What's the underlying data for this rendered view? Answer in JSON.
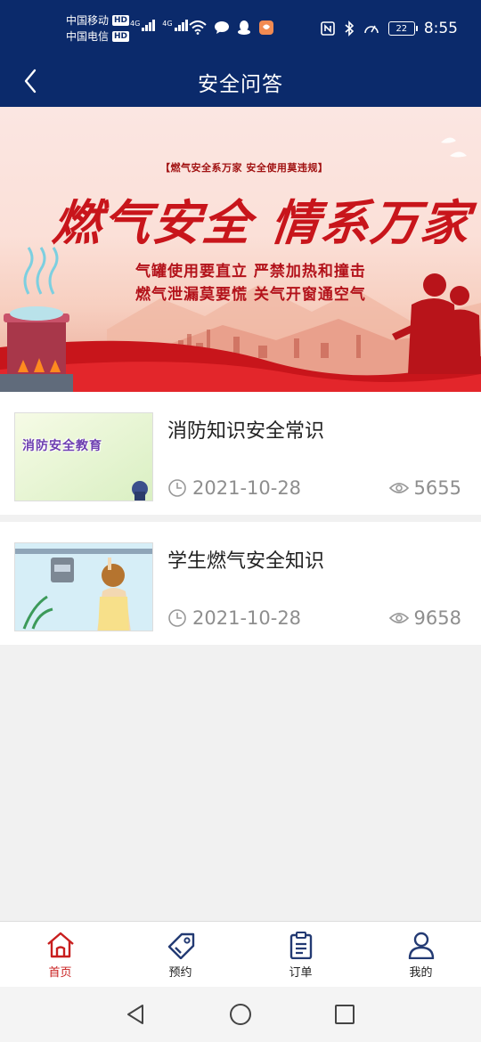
{
  "status_bar": {
    "carrier_1": "中国移动",
    "carrier_2": "中国电信",
    "hd_badge": "HD",
    "net_type": "4G",
    "battery_level": "22",
    "time": "8:55"
  },
  "header": {
    "title": "安全问答",
    "back_icon": "chevron-left-icon"
  },
  "banner": {
    "tag": "【燃气安全系万家 安全使用莫违规】",
    "headline": "燃气安全 情系万家",
    "line_1": "气罐使用要直立 严禁加热和撞击",
    "line_2": "燃气泄漏莫要慌 关气开窗通空气"
  },
  "articles": [
    {
      "title": "消防知识安全常识",
      "date": "2021-10-28",
      "views": "5655",
      "thumb_text": "消防安全教育"
    },
    {
      "title": "学生燃气安全知识",
      "date": "2021-10-28",
      "views": "9658"
    }
  ],
  "bottom_nav": [
    {
      "label": "首页",
      "icon": "home-icon",
      "active": true
    },
    {
      "label": "预约",
      "icon": "tag-icon",
      "active": false
    },
    {
      "label": "订单",
      "icon": "clipboard-icon",
      "active": false
    },
    {
      "label": "我的",
      "icon": "user-icon",
      "active": false
    }
  ],
  "colors": {
    "header_bg": "#0b2a6b",
    "accent_red": "#c81e1e",
    "meta_gray": "#8e8e8e"
  }
}
